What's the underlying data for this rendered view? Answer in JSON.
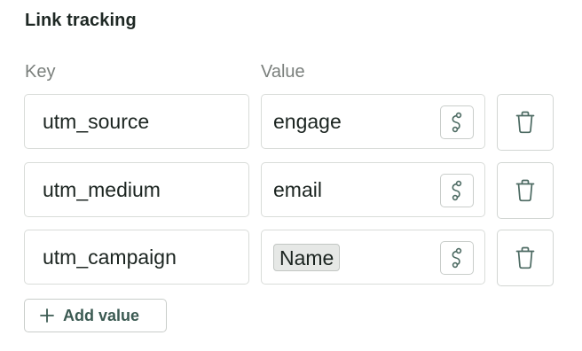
{
  "section": {
    "title": "Link tracking"
  },
  "columns": {
    "key_label": "Key",
    "value_label": "Value"
  },
  "rows": [
    {
      "key": "utm_source",
      "value": "engage",
      "value_type": "text"
    },
    {
      "key": "utm_medium",
      "value": "email",
      "value_type": "text"
    },
    {
      "key": "utm_campaign",
      "value": "Name",
      "value_type": "variable-token"
    }
  ],
  "actions": {
    "add_value_label": "Add value"
  },
  "icons": {
    "variable": "variable-path-icon",
    "delete": "trash-icon",
    "add": "plus-icon"
  },
  "colors": {
    "accent": "#3b5a52",
    "icon": "#4c6a62",
    "border": "#d9dcd9",
    "token_bg": "#e6e8e6",
    "muted_text": "#7a7f7c"
  }
}
